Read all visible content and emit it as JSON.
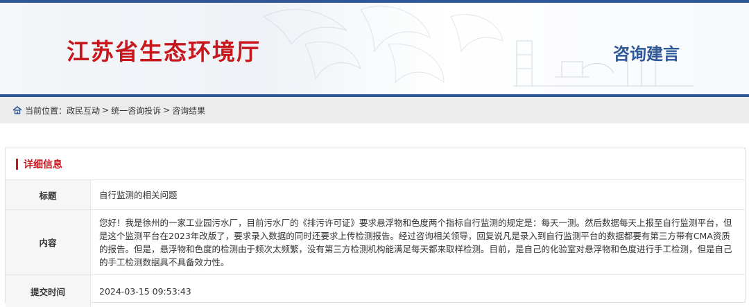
{
  "header": {
    "site_title": "江苏省生态环境厅",
    "section_title": "咨询建言"
  },
  "breadcrumb": {
    "icon": "home-icon",
    "label": "当前位置：",
    "items": [
      "政民互动",
      "统一咨询投诉",
      "咨询结果"
    ],
    "separator": ">"
  },
  "detail": {
    "heading": "详细信息",
    "rows": [
      {
        "label": "标题",
        "value": "自行监测的相关问题"
      },
      {
        "label": "内容",
        "value": "您好！我是徐州的一家工业园污水厂，目前污水厂的《排污许可证》要求悬浮物和色度两个指标自行监测的规定是：每天一测。然后数据每天上报至自行监测平台，但是这个监测平台在2023年改版了，要求录入数据的同时还要求上传检测报告。经过咨询相关领导，回复说凡是录入到自行监测平台的数据都要有第三方带有CMA资质的报告。但是，悬浮物和色度的检测由于频次太频繁，没有第三方检测机构能满足每天都来取样检测。目前，是自己的化验室对悬浮物和色度进行手工检测，但是自己的手工检测数据具不具备效力性。"
      },
      {
        "label": "提交时间",
        "value": "2024-03-15 09:53:43"
      }
    ]
  },
  "colors": {
    "brand_red": "#c8161d",
    "brand_blue": "#2d5797",
    "breadcrumb_bg": "#ececec",
    "label_bg": "#f6f6f6"
  }
}
